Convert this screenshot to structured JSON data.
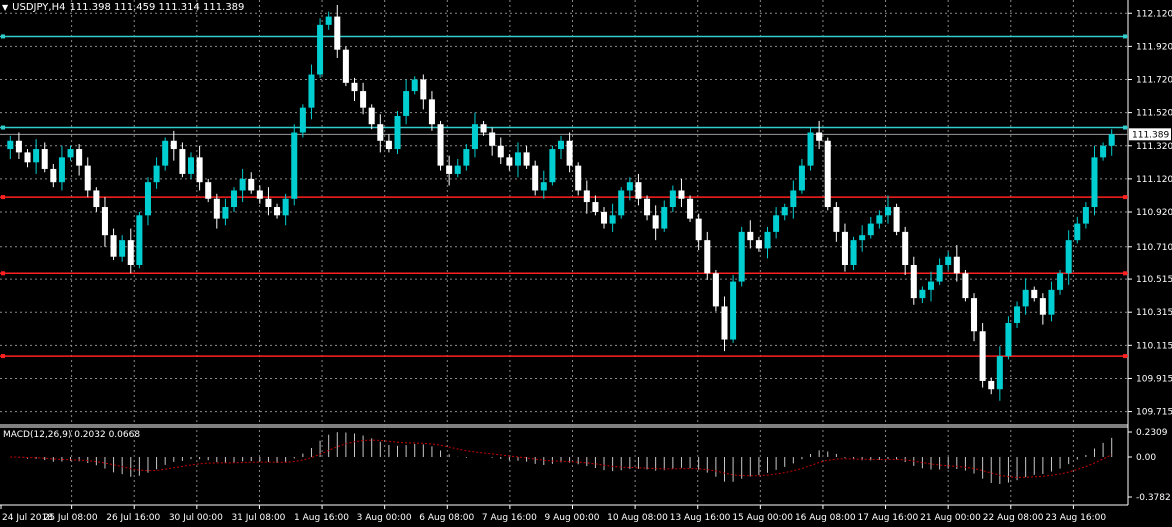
{
  "header": {
    "arrow": "▼",
    "symbol": "USDJPY,H4",
    "ohlc": "111.398 111.459 111.314 111.389"
  },
  "macd": {
    "label": "MACD(12,26,9) 0.2032 0.0668",
    "axis_labels": [
      "0.2309",
      "0.00",
      "-0.3782"
    ]
  },
  "chart_data": {
    "type": "candlestick",
    "ylim": [
      109.64,
      112.2
    ],
    "price_ticks": [
      "112.120",
      "111.920",
      "111.720",
      "111.520",
      "111.320",
      "111.120",
      "110.920",
      "110.710",
      "110.515",
      "110.315",
      "110.115",
      "109.915",
      "109.715"
    ],
    "current_price_label": "111.389",
    "x_labels": [
      "24 Jul 2018",
      "25 Jul 08:00",
      "26 Jul 16:00",
      "30 Jul 00:00",
      "31 Jul 08:00",
      "1 Aug 16:00",
      "3 Aug 00:00",
      "6 Aug 08:00",
      "7 Aug 16:00",
      "9 Aug 00:00",
      "10 Aug 08:00",
      "13 Aug 16:00",
      "15 Aug 00:00",
      "16 Aug 08:00",
      "17 Aug 16:00",
      "21 Aug 00:00",
      "22 Aug 08:00",
      "23 Aug 16:00"
    ],
    "hlines_cyan": [
      111.98,
      111.43
    ],
    "hlines_red": [
      111.01,
      110.55,
      110.05
    ],
    "colors": {
      "bull": "#00CED1",
      "bear": "#FFFFFF",
      "grid": "#8a8a8a",
      "hline_cyan": "#33CCCC",
      "hline_red": "#FF2020",
      "macd_hist": "#C8C8C8",
      "macd_signal": "#C80000"
    },
    "closes": [
      111.35,
      111.28,
      111.22,
      111.3,
      111.18,
      111.1,
      111.25,
      111.3,
      111.2,
      111.05,
      110.95,
      110.78,
      110.65,
      110.75,
      110.6,
      110.9,
      111.1,
      111.2,
      111.35,
      111.3,
      111.15,
      111.25,
      111.1,
      111.0,
      110.88,
      110.95,
      111.05,
      111.12,
      111.05,
      111.0,
      110.95,
      110.9,
      111.0,
      111.4,
      111.55,
      111.75,
      112.05,
      112.1,
      111.9,
      111.7,
      111.65,
      111.55,
      111.45,
      111.35,
      111.3,
      111.5,
      111.65,
      111.72,
      111.6,
      111.45,
      111.2,
      111.15,
      111.2,
      111.3,
      111.45,
      111.4,
      111.32,
      111.25,
      111.2,
      111.28,
      111.2,
      111.05,
      111.1,
      111.3,
      111.35,
      111.2,
      111.05,
      110.98,
      110.92,
      110.85,
      110.9,
      111.05,
      111.1,
      111.0,
      110.9,
      110.82,
      110.95,
      111.05,
      111.0,
      110.88,
      110.75,
      110.55,
      110.35,
      110.15,
      110.5,
      110.8,
      110.75,
      110.7,
      110.8,
      110.9,
      110.95,
      111.05,
      111.2,
      111.4,
      111.35,
      110.95,
      110.8,
      110.6,
      110.75,
      110.78,
      110.85,
      110.9,
      110.95,
      110.8,
      110.6,
      110.4,
      110.45,
      110.5,
      110.6,
      110.65,
      110.55,
      110.4,
      110.2,
      109.9,
      109.85,
      110.05,
      110.25,
      110.35,
      110.45,
      110.4,
      110.3,
      110.45,
      110.55,
      110.75,
      110.85,
      110.95,
      111.25,
      111.32,
      111.39
    ]
  }
}
